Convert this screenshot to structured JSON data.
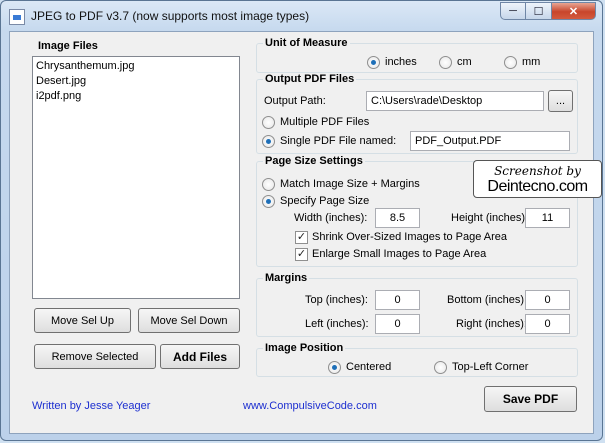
{
  "window": {
    "title": "JPEG to PDF  v3.7    (now supports most image types)",
    "min_glyph": "─",
    "max_glyph": "☐",
    "close_glyph": "✕"
  },
  "image_files": {
    "title": "Image Files",
    "items": [
      "Chrysanthemum.jpg",
      "Desert.jpg",
      "i2pdf.png"
    ],
    "move_up": "Move Sel Up",
    "move_down": "Move Sel Down",
    "remove": "Remove Selected",
    "add": "Add Files"
  },
  "unit": {
    "title": "Unit of Measure",
    "options": [
      "inches",
      "cm",
      "mm"
    ],
    "selected": "inches"
  },
  "output": {
    "title": "Output PDF Files",
    "path_label": "Output Path:",
    "path_value": "C:\\Users\\rade\\Desktop",
    "browse": "...",
    "multiple": "Multiple PDF Files",
    "single": "Single PDF File named:",
    "single_value": "PDF_Output.PDF",
    "selected": "single"
  },
  "page_size": {
    "title": "Page Size Settings",
    "match": "Match Image Size + Margins",
    "specify": "Specify Page Size",
    "selected": "specify",
    "width_label": "Width (inches):",
    "width_value": "8.5",
    "height_label": "Height (inches):",
    "height_value": "11",
    "shrink": "Shrink Over-Sized Images to Page Area",
    "enlarge": "Enlarge Small Images to Page Area",
    "shrink_checked": true,
    "enlarge_checked": true,
    "check_glyph": "✓"
  },
  "margins": {
    "title": "Margins",
    "top_label": "Top (inches):",
    "top_value": "0",
    "bottom_label": "Bottom (inches):",
    "bottom_value": "0",
    "left_label": "Left (inches):",
    "left_value": "0",
    "right_label": "Right (inches):",
    "right_value": "0"
  },
  "position": {
    "title": "Image Position",
    "centered": "Centered",
    "top_left": "Top-Left Corner",
    "selected": "centered"
  },
  "footer": {
    "author": "Written by Jesse Yeager",
    "website": "www.CompulsiveCode.com",
    "save": "Save PDF"
  },
  "watermark": {
    "line1": "Screenshot by",
    "line2": "Deintecno.com"
  },
  "colors": {
    "link": "#1d2fd0",
    "radio_dot": "#1e6fb8",
    "close_button": "#c8452b"
  }
}
